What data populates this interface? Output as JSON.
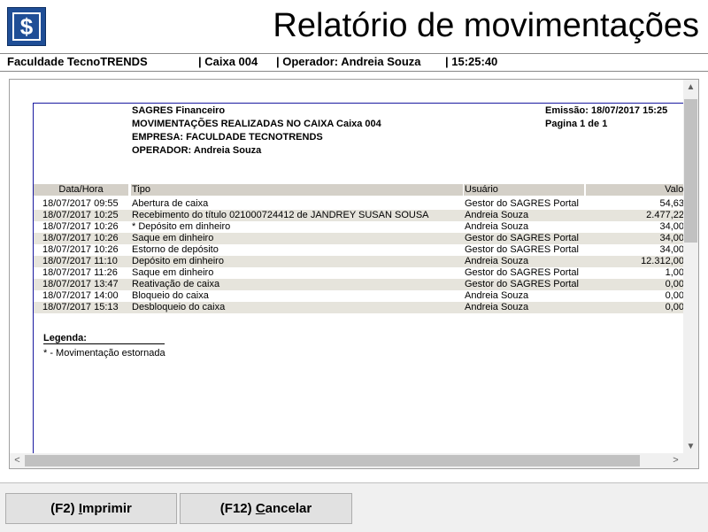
{
  "header": {
    "logo_glyph": "$",
    "title": "Relatório de movimentações"
  },
  "infobar": {
    "company": "Faculdade TecnoTRENDS",
    "caixa": "| Caixa 004",
    "operador": "| Operador: Andreia Souza",
    "time": "| 15:25:40"
  },
  "report": {
    "system": "SAGRES Financeiro",
    "subtitle": "MOVIMENTAÇÕES REALIZADAS NO CAIXA Caixa 004",
    "empresa": "EMPRESA: FACULDADE TECNOTRENDS",
    "operador": "OPERADOR: Andreia Souza",
    "emissao": "Emissão: 18/07/2017 15:25",
    "pagina": "Pagina 1 de 1",
    "columns": {
      "date": "Data/Hora",
      "tipo": "Tipo",
      "usuario": "Usuário",
      "valor": "Valor"
    },
    "rows": [
      {
        "date": "18/07/2017 09:55",
        "tipo": "Abertura de caixa",
        "usuario": "Gestor do SAGRES Portal",
        "valor": "54,63"
      },
      {
        "date": "18/07/2017 10:25",
        "tipo": "Recebimento do título 021000724412 de JANDREY SUSAN SOUSA",
        "usuario": "Andreia Souza",
        "valor": "2.477,22"
      },
      {
        "date": "18/07/2017 10:26",
        "tipo": "* Depósito em dinheiro",
        "usuario": "Andreia Souza",
        "valor": "34,00"
      },
      {
        "date": "18/07/2017 10:26",
        "tipo": "Saque em dinheiro",
        "usuario": "Gestor do SAGRES Portal",
        "valor": "34,00"
      },
      {
        "date": "18/07/2017 10:26",
        "tipo": "Estorno de depósito",
        "usuario": "Gestor do SAGRES Portal",
        "valor": "34,00"
      },
      {
        "date": "18/07/2017 11:10",
        "tipo": "Depósito em dinheiro",
        "usuario": "Andreia Souza",
        "valor": "12.312,00"
      },
      {
        "date": "18/07/2017 11:26",
        "tipo": "Saque em dinheiro",
        "usuario": "Gestor do SAGRES Portal",
        "valor": "1,00"
      },
      {
        "date": "18/07/2017 13:47",
        "tipo": "Reativação de caixa",
        "usuario": "Gestor do SAGRES Portal",
        "valor": "0,00"
      },
      {
        "date": "18/07/2017 14:00",
        "tipo": "Bloqueio do caixa",
        "usuario": "Andreia Souza",
        "valor": "0,00"
      },
      {
        "date": "18/07/2017 15:13",
        "tipo": "Desbloqueio do caixa",
        "usuario": "Andreia Souza",
        "valor": "0,00"
      }
    ],
    "legend_title": "Legenda:",
    "legend_item": "* - Movimentação estornada"
  },
  "scroll": {
    "up": "▲",
    "down": "▼",
    "left": "<",
    "right": ">"
  },
  "footer": {
    "print_label": "(F2) Imprimir",
    "cancel_label": "(F12) Cancelar"
  },
  "colors": {
    "logo": "#1f4e96",
    "page_border": "#1a1aa0",
    "header_row": "#d4d0c8"
  }
}
